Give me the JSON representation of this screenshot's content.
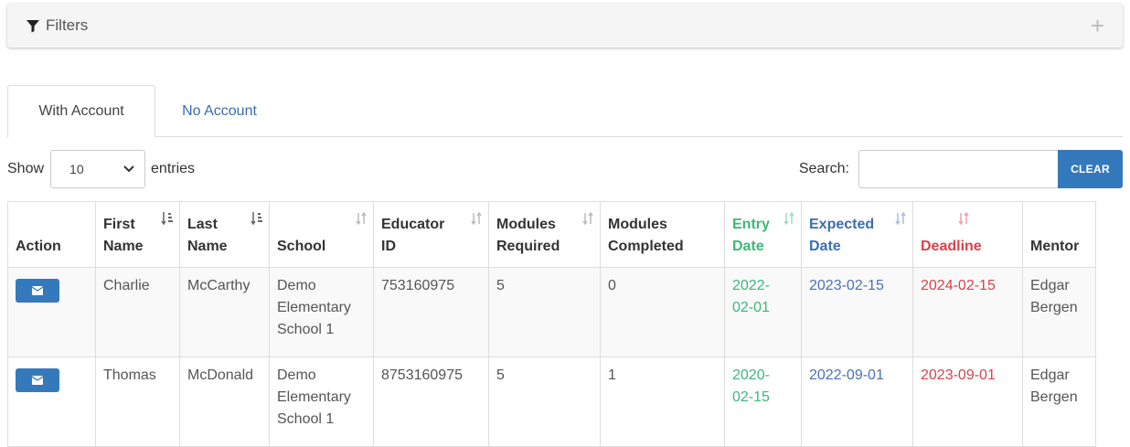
{
  "filters": {
    "title": "Filters",
    "expand_symbol": "+"
  },
  "tabs": [
    {
      "label": "With Account",
      "active": true
    },
    {
      "label": "No Account",
      "active": false
    }
  ],
  "length": {
    "show_label": "Show",
    "value": "10",
    "entries_label": "entries"
  },
  "search": {
    "label": "Search:",
    "value": "",
    "clear_label": "CLEAR"
  },
  "table": {
    "headers": {
      "action": "Action",
      "first_name": [
        "First",
        "Name"
      ],
      "last_name": [
        "Last",
        "Name"
      ],
      "school": "School",
      "educator_id": [
        "Educator",
        "ID"
      ],
      "modules_required": [
        "Modules",
        "Required"
      ],
      "modules_completed": [
        "Modules",
        "Completed"
      ],
      "entry_date": [
        "Entry",
        "Date"
      ],
      "expected_date": [
        "Expected",
        "Date"
      ],
      "deadline": "Deadline",
      "mentor": "Mentor"
    },
    "rows": [
      {
        "first_name": "Charlie",
        "last_name": "McCarthy",
        "school": [
          "Demo",
          "Elementary",
          "School 1"
        ],
        "educator_id": "753160975",
        "modules_required": "5",
        "modules_completed": "0",
        "entry_date": [
          "2022-",
          "02-01"
        ],
        "expected_date": "2023-02-15",
        "deadline": "2024-02-15",
        "mentor": [
          "Edgar",
          "Bergen"
        ]
      },
      {
        "first_name": "Thomas",
        "last_name": "McDonald",
        "school": [
          "Demo",
          "Elementary",
          "School 1"
        ],
        "educator_id": "8753160975",
        "modules_required": "5",
        "modules_completed": "1",
        "entry_date": [
          "2020-",
          "02-15"
        ],
        "expected_date": "2022-09-01",
        "deadline": "2023-09-01",
        "mentor": [
          "Edgar",
          "Bergen"
        ]
      }
    ]
  },
  "colors": {
    "primary": "#3579bd",
    "entry": "#3cb878",
    "expected": "#3a6fb0",
    "deadline": "#d9434a"
  },
  "icons": [
    "funnel-icon",
    "plus-icon",
    "chevron-down-icon",
    "sort-icon",
    "sort-alpha-icon",
    "envelope-icon"
  ]
}
